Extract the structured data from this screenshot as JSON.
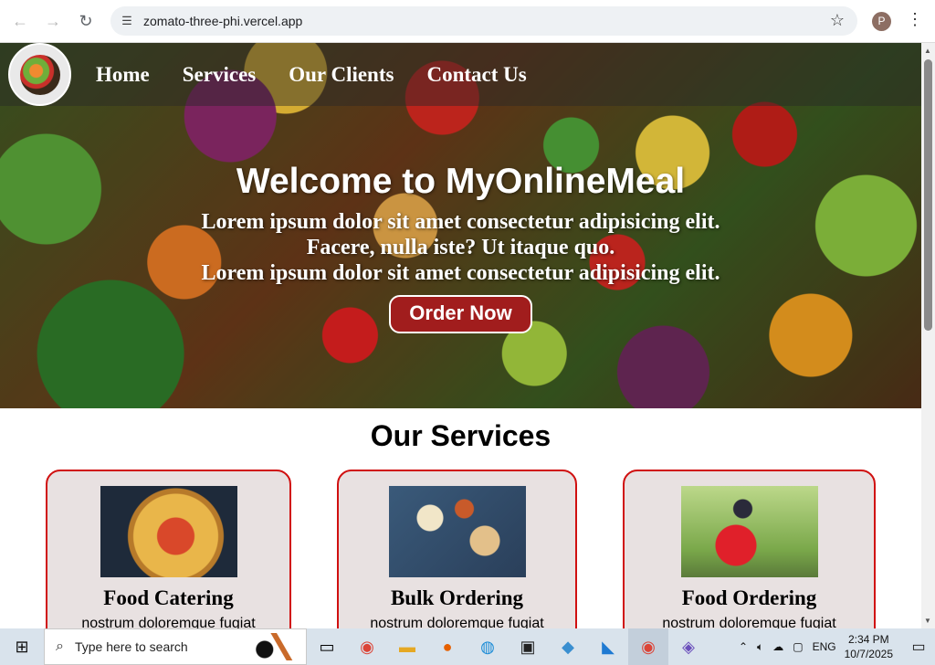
{
  "browser": {
    "url": "zomato-three-phi.vercel.app",
    "profile_initial": "P",
    "icons": [
      "back-icon",
      "forward-icon",
      "reload-icon",
      "site-info-icon",
      "bookmark-star-icon",
      "kebab-menu-icon"
    ]
  },
  "nav": {
    "items": [
      "Home",
      "Services",
      "Our Clients",
      "Contact Us"
    ]
  },
  "hero": {
    "title": "Welcome to MyOnlineMeal",
    "line1": "Lorem ipsum dolor sit amet consectetur adipisicing elit. Facere, nulla iste? Ut itaque quo.",
    "line2": "Lorem ipsum dolor sit amet consectetur adipisicing elit.",
    "button": "Order Now"
  },
  "services": {
    "title": "Our Services",
    "cards": [
      {
        "title": "Food Catering",
        "text": "nostrum doloremque fugiat"
      },
      {
        "title": "Bulk Ordering",
        "text": "nostrum doloremque fugiat"
      },
      {
        "title": "Food Ordering",
        "text": "nostrum doloremque fugiat"
      }
    ]
  },
  "taskbar": {
    "search_placeholder": "Type here to search",
    "language": "ENG",
    "time": "2:34 PM",
    "date": "10/7/2025"
  },
  "colors": {
    "accent_red": "#a11d1d",
    "card_border": "#d01010",
    "card_bg": "#e8e1e1"
  }
}
